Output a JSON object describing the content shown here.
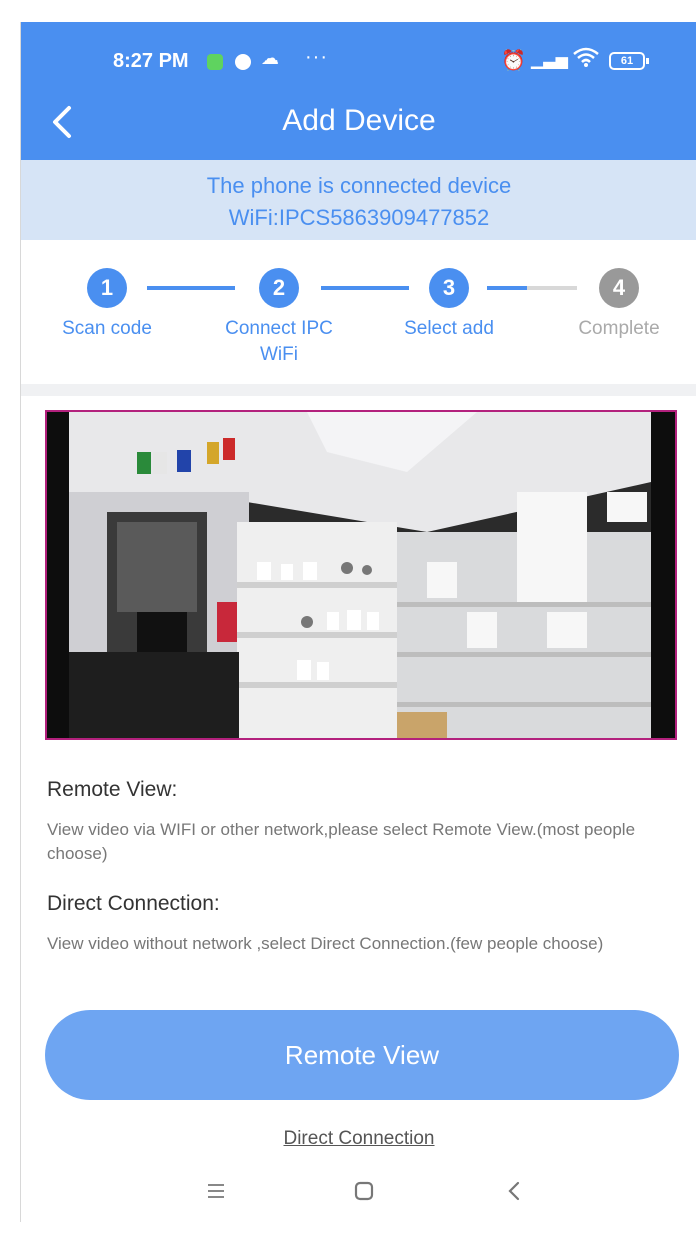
{
  "status_bar": {
    "time": "8:27 PM",
    "more": "···",
    "battery": "61"
  },
  "header": {
    "title": "Add Device"
  },
  "banner": {
    "line1": "The phone is connected device",
    "line2": "WiFi:IPCS5863909477852"
  },
  "steps": [
    {
      "number": "1",
      "label": "Scan code",
      "label_line2": "",
      "state": "done"
    },
    {
      "number": "2",
      "label": "Connect IPC",
      "label_line2": "WiFi",
      "state": "done"
    },
    {
      "number": "3",
      "label": "Select add",
      "label_line2": "",
      "state": "current"
    },
    {
      "number": "4",
      "label": "Complete",
      "label_line2": "",
      "state": "pending"
    }
  ],
  "info": {
    "remote_heading": "Remote View:",
    "remote_desc": "View video via WIFI or other network,please select Remote View.(most people choose)",
    "direct_heading": "Direct Connection:",
    "direct_desc": "View video without network ,select Direct Connection.(few people choose)"
  },
  "actions": {
    "remote_button": "Remote View",
    "direct_link": "Direct Connection"
  },
  "colors": {
    "accent": "#4a8ff0",
    "banner_bg": "#d6e4f6",
    "button": "#6ea5f2",
    "pending_step": "#999999"
  }
}
